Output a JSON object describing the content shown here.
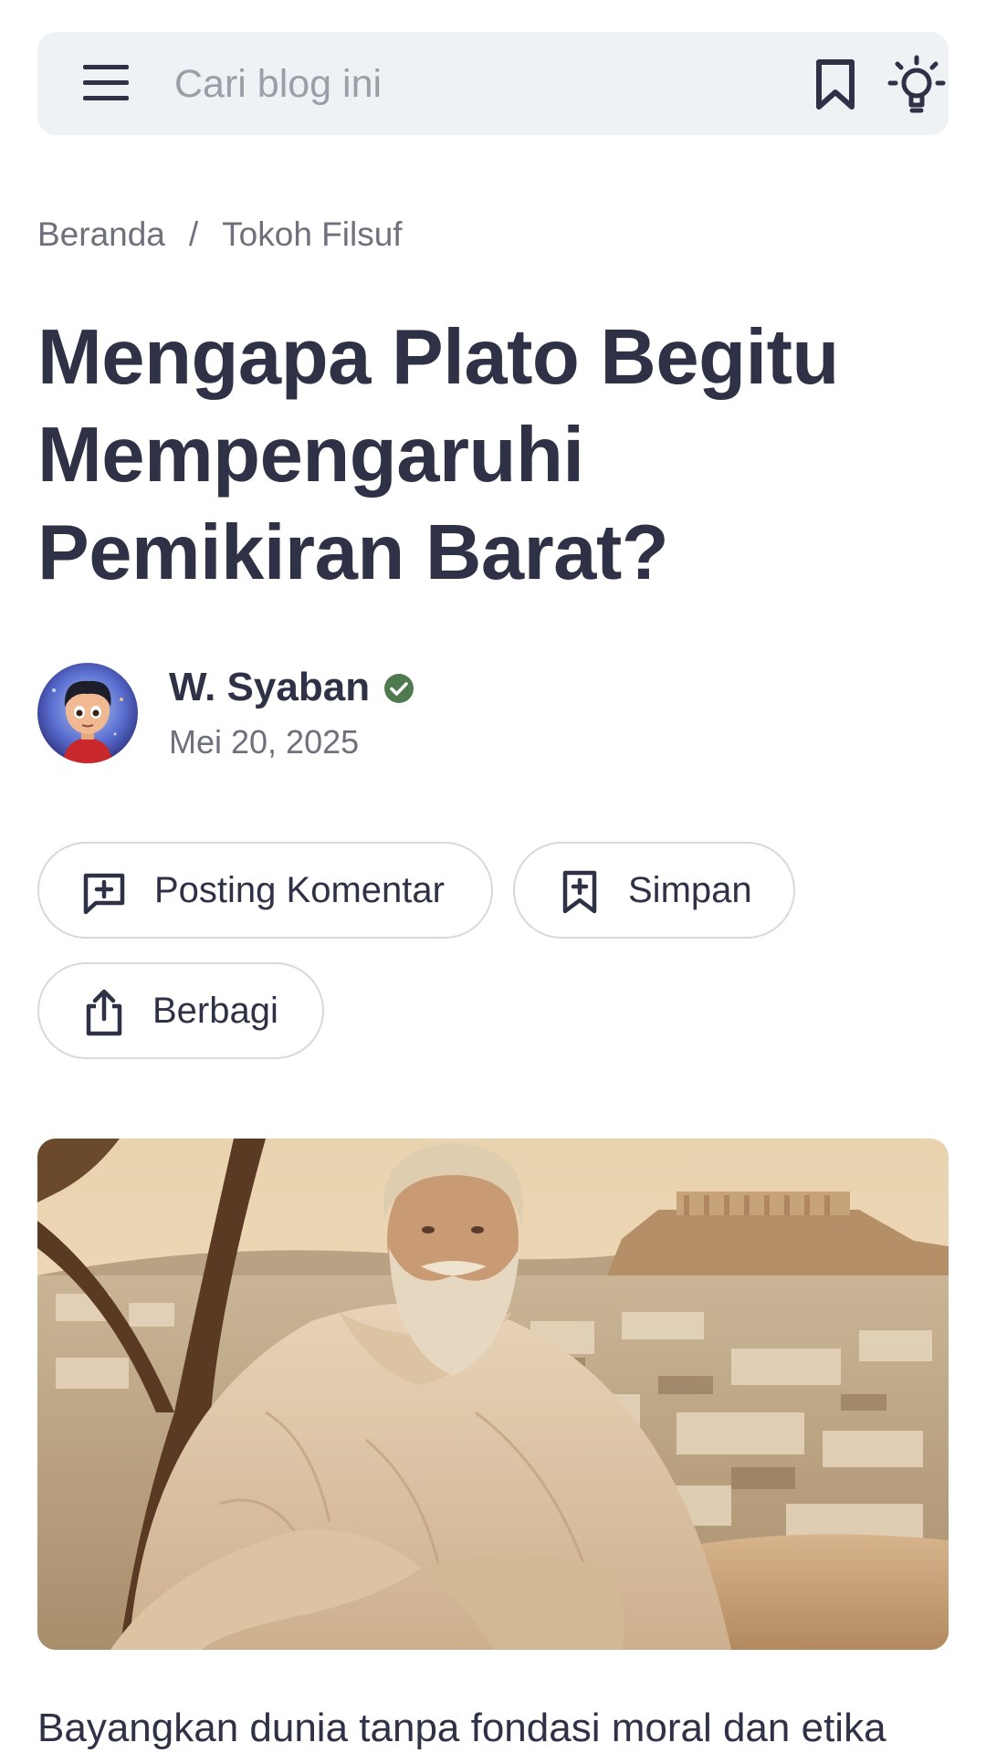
{
  "header": {
    "search_placeholder": "Cari blog ini",
    "menu_icon": "menu-icon",
    "bookmark_icon": "bookmark-icon",
    "theme_icon": "lightbulb-icon"
  },
  "breadcrumb": {
    "items": [
      "Beranda",
      "Tokoh Filsuf"
    ],
    "separator": "/"
  },
  "article": {
    "title": "Mengapa Plato Begitu Mempengaruhi Pemikiran Barat?",
    "author": {
      "name": "W. Syaban",
      "verified": true,
      "verified_color": "#4f7a4f"
    },
    "date": "Mei 20, 2025",
    "actions": {
      "comment_label": "Posting Komentar",
      "save_label": "Simpan",
      "share_label": "Berbagi"
    },
    "first_line": "Bayangkan dunia tanpa fondasi moral dan etika"
  },
  "colors": {
    "text_primary": "#2f3246",
    "text_secondary": "#6e717c",
    "topbar_bg": "#eff2f4",
    "pill_border": "#d7d9de"
  }
}
